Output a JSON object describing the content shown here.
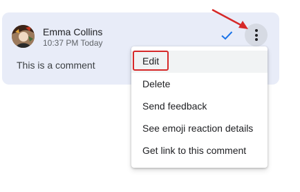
{
  "comment": {
    "author": "Emma Collins",
    "timestamp": "10:37 PM Today",
    "text": "This is a comment"
  },
  "actions": {
    "resolve_icon": "checkmark-icon",
    "more_icon": "more-vert-icon"
  },
  "menu": {
    "items": [
      {
        "label": "Edit"
      },
      {
        "label": "Delete"
      },
      {
        "label": "Send feedback"
      },
      {
        "label": "See emoji reaction details"
      },
      {
        "label": "Get link to this comment"
      }
    ]
  },
  "colors": {
    "card_background": "#e8ecf8",
    "check_blue": "#1a73e8",
    "annotation_red": "#d62828"
  }
}
